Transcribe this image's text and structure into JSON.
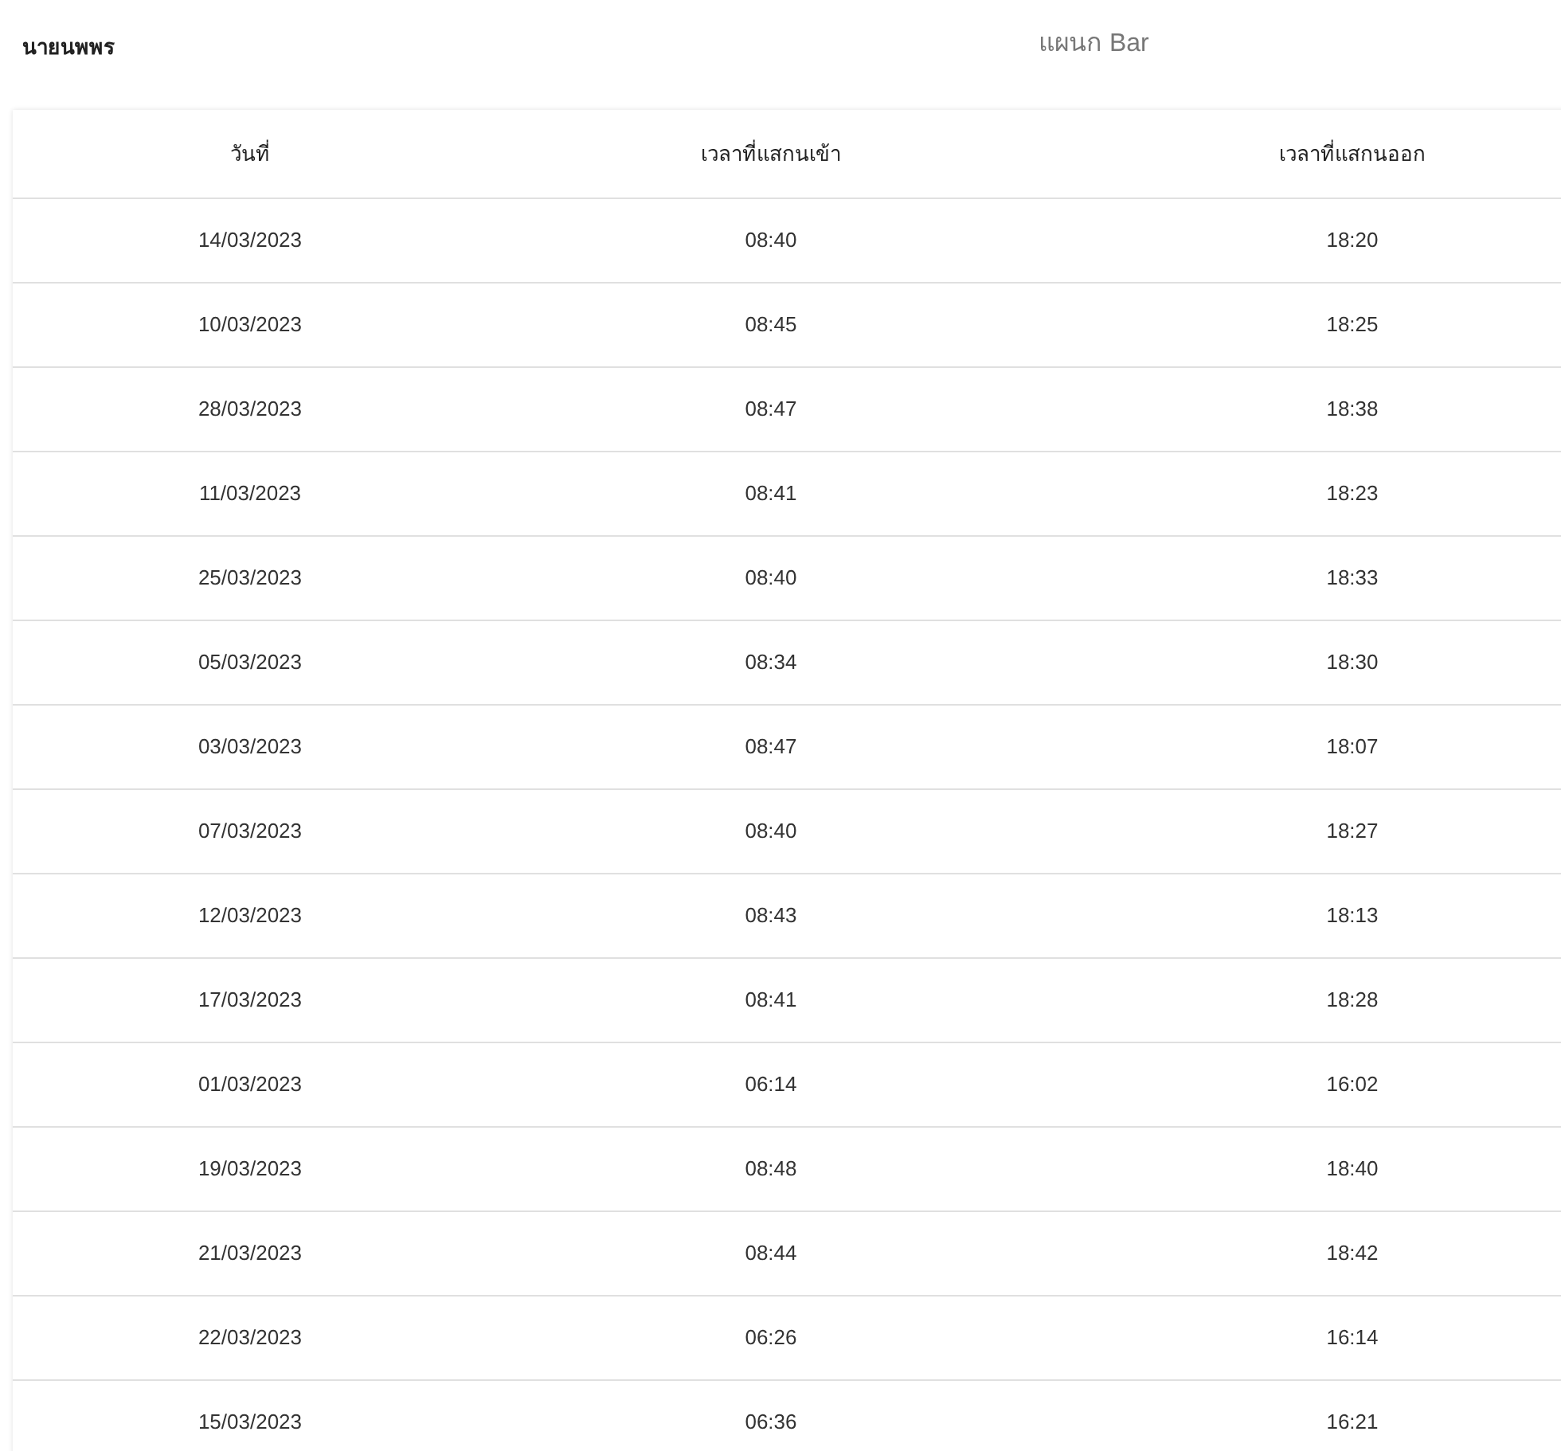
{
  "employee_name": "นายนพพร",
  "department": "แผนก Bar",
  "table": {
    "columns": [
      "วันที่",
      "เวลาที่แสกนเข้า",
      "เวลาที่แสกนออก"
    ],
    "rows": [
      [
        "14/03/2023",
        "08:40",
        "18:20"
      ],
      [
        "10/03/2023",
        "08:45",
        "18:25"
      ],
      [
        "28/03/2023",
        "08:47",
        "18:38"
      ],
      [
        "11/03/2023",
        "08:41",
        "18:23"
      ],
      [
        "25/03/2023",
        "08:40",
        "18:33"
      ],
      [
        "05/03/2023",
        "08:34",
        "18:30"
      ],
      [
        "03/03/2023",
        "08:47",
        "18:07"
      ],
      [
        "07/03/2023",
        "08:40",
        "18:27"
      ],
      [
        "12/03/2023",
        "08:43",
        "18:13"
      ],
      [
        "17/03/2023",
        "08:41",
        "18:28"
      ],
      [
        "01/03/2023",
        "06:14",
        "16:02"
      ],
      [
        "19/03/2023",
        "08:48",
        "18:40"
      ],
      [
        "21/03/2023",
        "08:44",
        "18:42"
      ],
      [
        "22/03/2023",
        "06:26",
        "16:14"
      ],
      [
        "15/03/2023",
        "06:36",
        "16:21"
      ]
    ]
  }
}
